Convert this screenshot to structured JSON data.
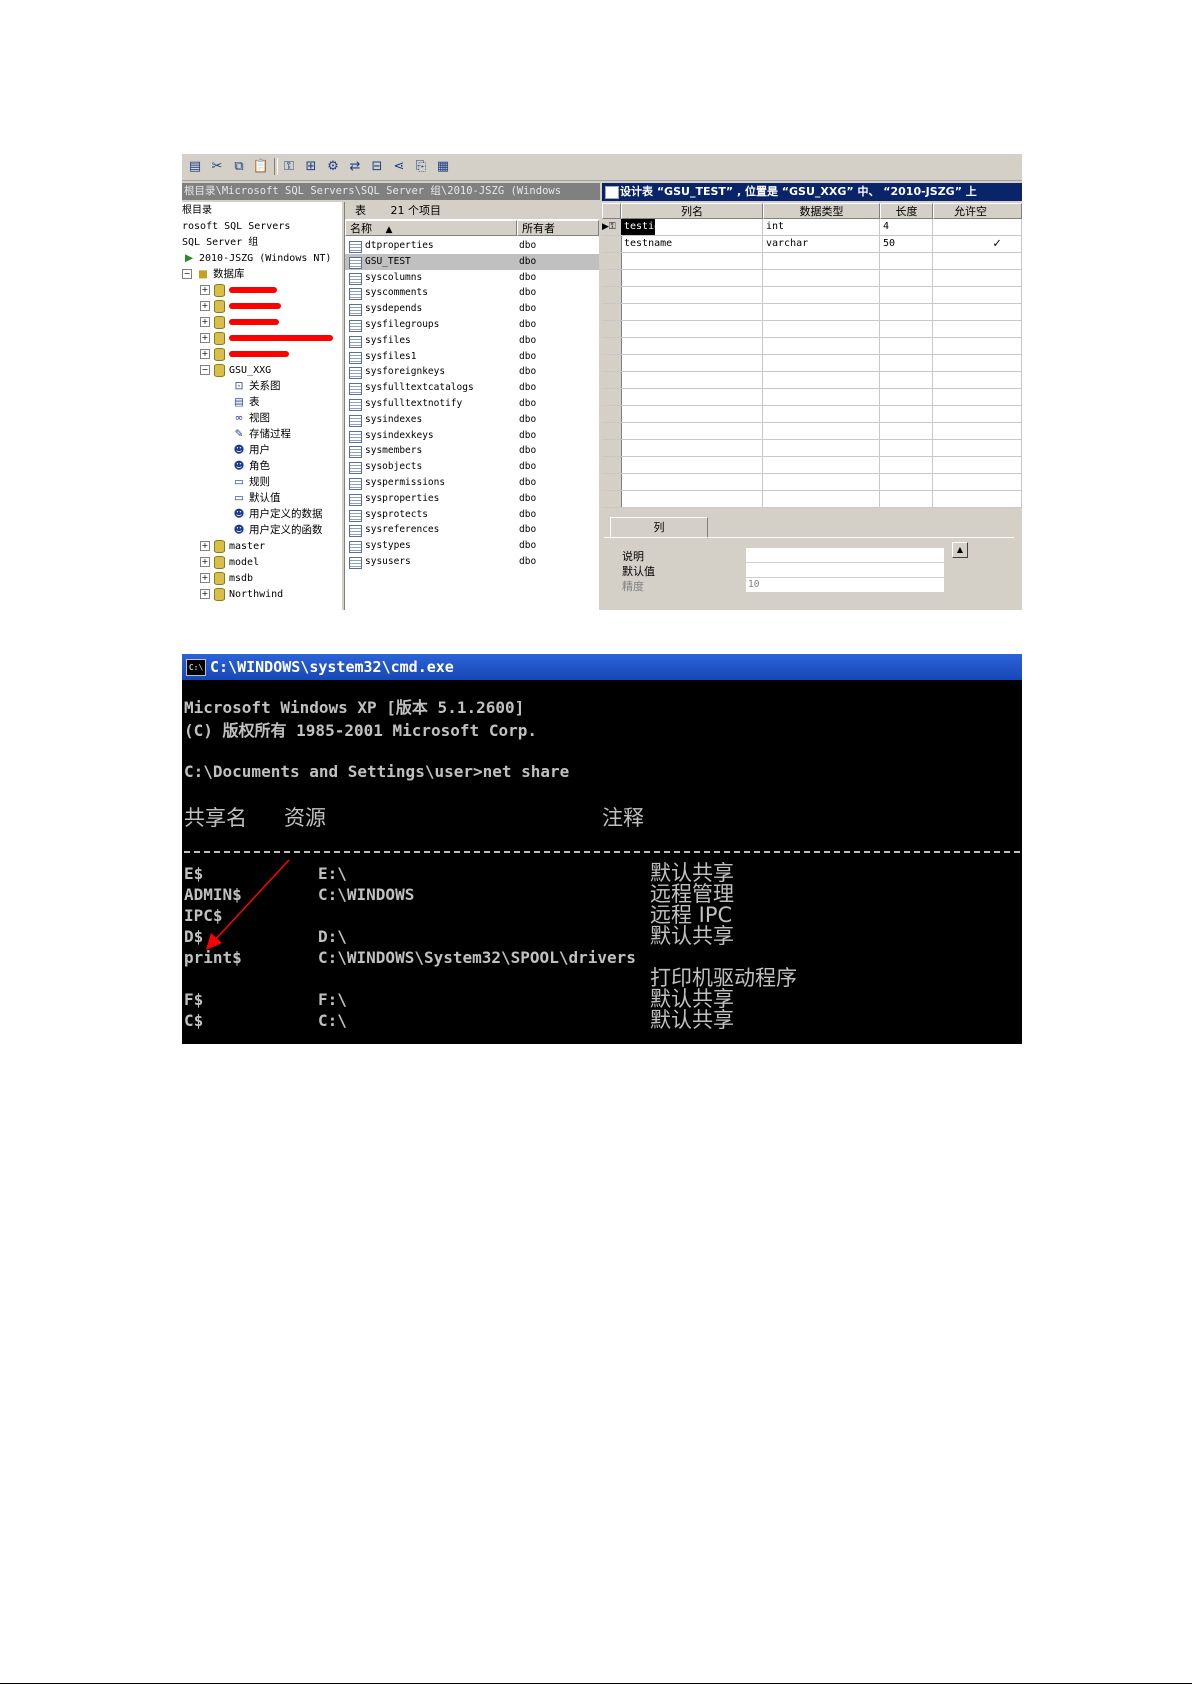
{
  "enterprise_manager": {
    "path_text": "根目录\\Microsoft SQL Servers\\SQL Server 组\\2010-JSZG (Windows",
    "tree": {
      "row1": "根目录",
      "row2": "rosoft SQL Servers",
      "row3": "SQL Server 组",
      "server": "2010-JSZG (Windows NT)",
      "databases": "数据库",
      "db_gsu_xxg": "GSU_XXG",
      "children": [
        "关系图",
        "表",
        "视图",
        "存储过程",
        "用户",
        "角色",
        "规则",
        "默认值",
        "用户定义的数据",
        "用户定义的函数"
      ],
      "other_dbs": [
        "master",
        "model",
        "msdb",
        "Northwind"
      ]
    },
    "list": {
      "caption_label": "表",
      "caption_count": "21 个项目",
      "col_name": "名称",
      "col_owner": "所有者",
      "rows": [
        {
          "name": "dtproperties",
          "owner": "dbo"
        },
        {
          "name": "GSU_TEST",
          "owner": "dbo"
        },
        {
          "name": "syscolumns",
          "owner": "dbo"
        },
        {
          "name": "syscomments",
          "owner": "dbo"
        },
        {
          "name": "sysdepends",
          "owner": "dbo"
        },
        {
          "name": "sysfilegroups",
          "owner": "dbo"
        },
        {
          "name": "sysfiles",
          "owner": "dbo"
        },
        {
          "name": "sysfiles1",
          "owner": "dbo"
        },
        {
          "name": "sysforeignkeys",
          "owner": "dbo"
        },
        {
          "name": "sysfulltextcatalogs",
          "owner": "dbo"
        },
        {
          "name": "sysfulltextnotify",
          "owner": "dbo"
        },
        {
          "name": "sysindexes",
          "owner": "dbo"
        },
        {
          "name": "sysindexkeys",
          "owner": "dbo"
        },
        {
          "name": "sysmembers",
          "owner": "dbo"
        },
        {
          "name": "sysobjects",
          "owner": "dbo"
        },
        {
          "name": "syspermissions",
          "owner": "dbo"
        },
        {
          "name": "sysproperties",
          "owner": "dbo"
        },
        {
          "name": "sysprotects",
          "owner": "dbo"
        },
        {
          "name": "sysreferences",
          "owner": "dbo"
        },
        {
          "name": "systypes",
          "owner": "dbo"
        },
        {
          "name": "sysusers",
          "owner": "dbo"
        }
      ]
    },
    "designer": {
      "title": "设计表 “GSU_TEST” , 位置是 “GSU_XXG” 中、 “2010-JSZG” 上",
      "col_headers": [
        "列名",
        "数据类型",
        "长度",
        "允许空"
      ],
      "rows": [
        {
          "name": "testid",
          "type": "int",
          "length": "4",
          "nullable": ""
        },
        {
          "name": "testname",
          "type": "varchar",
          "length": "50",
          "nullable": "✓"
        }
      ],
      "tab_label": "列",
      "prop_labels": [
        "说明",
        "默认值",
        "精度"
      ],
      "precision_value": "10"
    }
  },
  "cmd": {
    "title": "C:\\WINDOWS\\system32\\cmd.exe",
    "icon_text": "C:\\",
    "line1": "Microsoft Windows XP [版本 5.1.2600]",
    "line2": "(C) 版权所有 1985-2001 Microsoft Corp.",
    "prompt": "C:\\Documents and Settings\\user>net share",
    "hdr_share": "共享名",
    "hdr_resource": "资源",
    "hdr_remark": "注释",
    "shares": [
      {
        "name": "E$",
        "resource": "E:\\",
        "remark": "默认共享"
      },
      {
        "name": "ADMIN$",
        "resource": "C:\\WINDOWS",
        "remark": "远程管理"
      },
      {
        "name": "IPC$",
        "resource": "",
        "remark": "远程 IPC"
      },
      {
        "name": "D$",
        "resource": "D:\\",
        "remark": "默认共享"
      },
      {
        "name": "print$",
        "resource": "C:\\WINDOWS\\System32\\SPOOL\\drivers",
        "remark": ""
      },
      {
        "name": "",
        "resource": "",
        "remark": "打印机驱动程序"
      },
      {
        "name": "F$",
        "resource": "F:\\",
        "remark": "默认共享"
      },
      {
        "name": "C$",
        "resource": "C:\\",
        "remark": "默认共享"
      }
    ]
  },
  "colors": {
    "window_face": "#d4d0c8",
    "title_blue": "#0a246a",
    "console_text": "#c0c0c0",
    "annotation_red": "#ff0000"
  }
}
